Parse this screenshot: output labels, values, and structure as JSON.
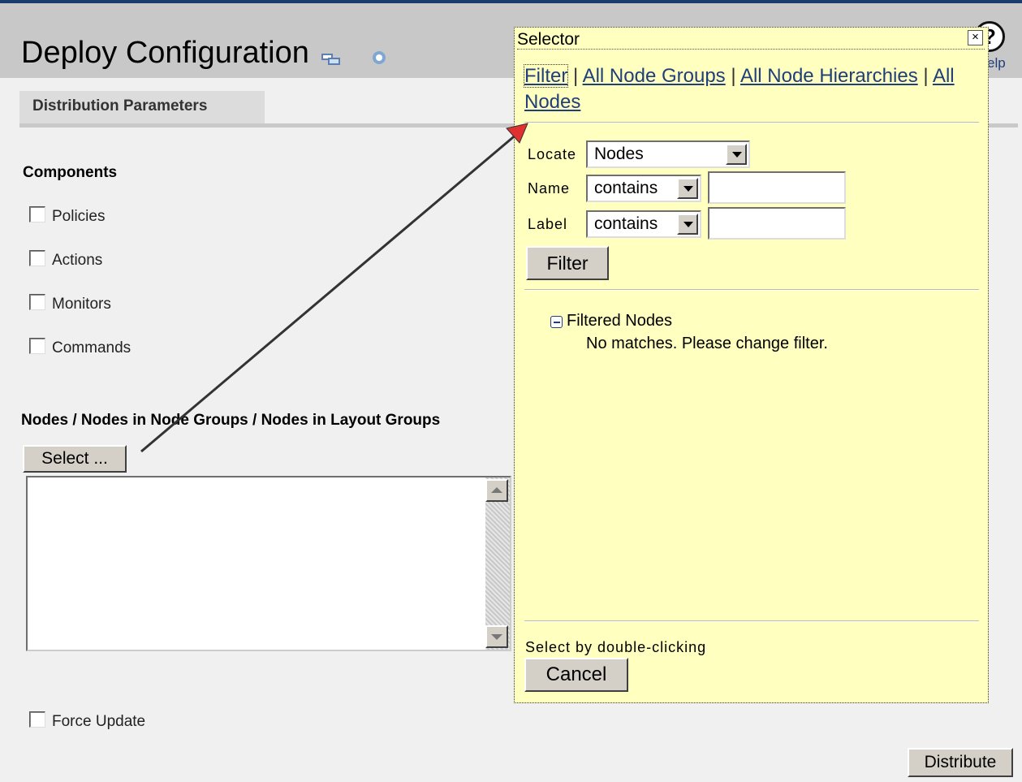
{
  "header": {
    "title": "Deploy Configuration",
    "help_label": "elp",
    "help_glyph": "?"
  },
  "tabs": [
    {
      "label": "Distribution Parameters",
      "selected": true
    }
  ],
  "components": {
    "label": "Components",
    "items": [
      {
        "label": "Policies",
        "checked": false
      },
      {
        "label": "Actions",
        "checked": false
      },
      {
        "label": "Monitors",
        "checked": false
      },
      {
        "label": "Commands",
        "checked": false
      }
    ]
  },
  "nodes": {
    "label": "Nodes / Nodes in Node Groups / Nodes in Layout Groups",
    "select_button": "Select ...",
    "selected_items": []
  },
  "force_update": {
    "label": "Force Update",
    "checked": false
  },
  "distribute_button": "Distribute",
  "selector": {
    "title": "Selector",
    "close_glyph": "×",
    "links": {
      "filter": "Filter",
      "all_node_groups": "All Node Groups",
      "all_node_hierarchies": "All Node Hierarchies",
      "all_nodes": "All Nodes",
      "separator": "|"
    },
    "locate_label": "Locate",
    "locate_value": "Nodes",
    "name_label": "Name",
    "name_operator": "contains",
    "name_value": "",
    "label_label": "Label",
    "label_operator": "contains",
    "label_value": "",
    "filter_button": "Filter",
    "tree_label": "Filtered Nodes",
    "tree_message": "No matches. Please change filter.",
    "hint": "Select by double-clicking",
    "cancel_button": "Cancel"
  },
  "colors": {
    "popup_background": "#ffffc0",
    "link": "#1f3f78",
    "arrow_head": "#e03030"
  }
}
